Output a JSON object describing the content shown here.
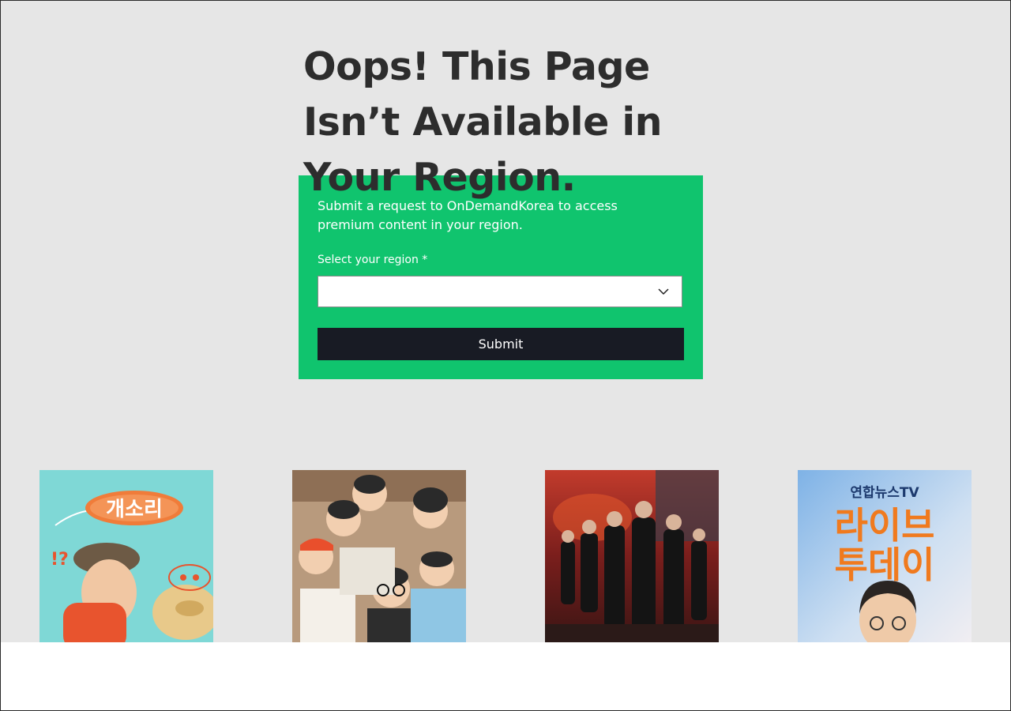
{
  "headline": "Oops! This Page Isn’t Available in Your Region.",
  "panel": {
    "description": "Submit a request to OnDemandKorea to access premium content in your region.",
    "region_label": "Select your region *",
    "region_value": "",
    "submit_label": "Submit"
  },
  "posters": [
    {
      "title_art": "개소리"
    },
    {
      "title_art": ""
    },
    {
      "title_art": ""
    },
    {
      "channel": "연합뉴스TV",
      "title_line1": "라이브",
      "title_line2": "투데이"
    }
  ],
  "colors": {
    "page_background": "#e6e6e6",
    "panel_green": "#10c46e",
    "button_dark": "#181b24",
    "headline_text": "#2d2d2d"
  },
  "icons": {
    "region_select": "chevron-down-icon"
  }
}
